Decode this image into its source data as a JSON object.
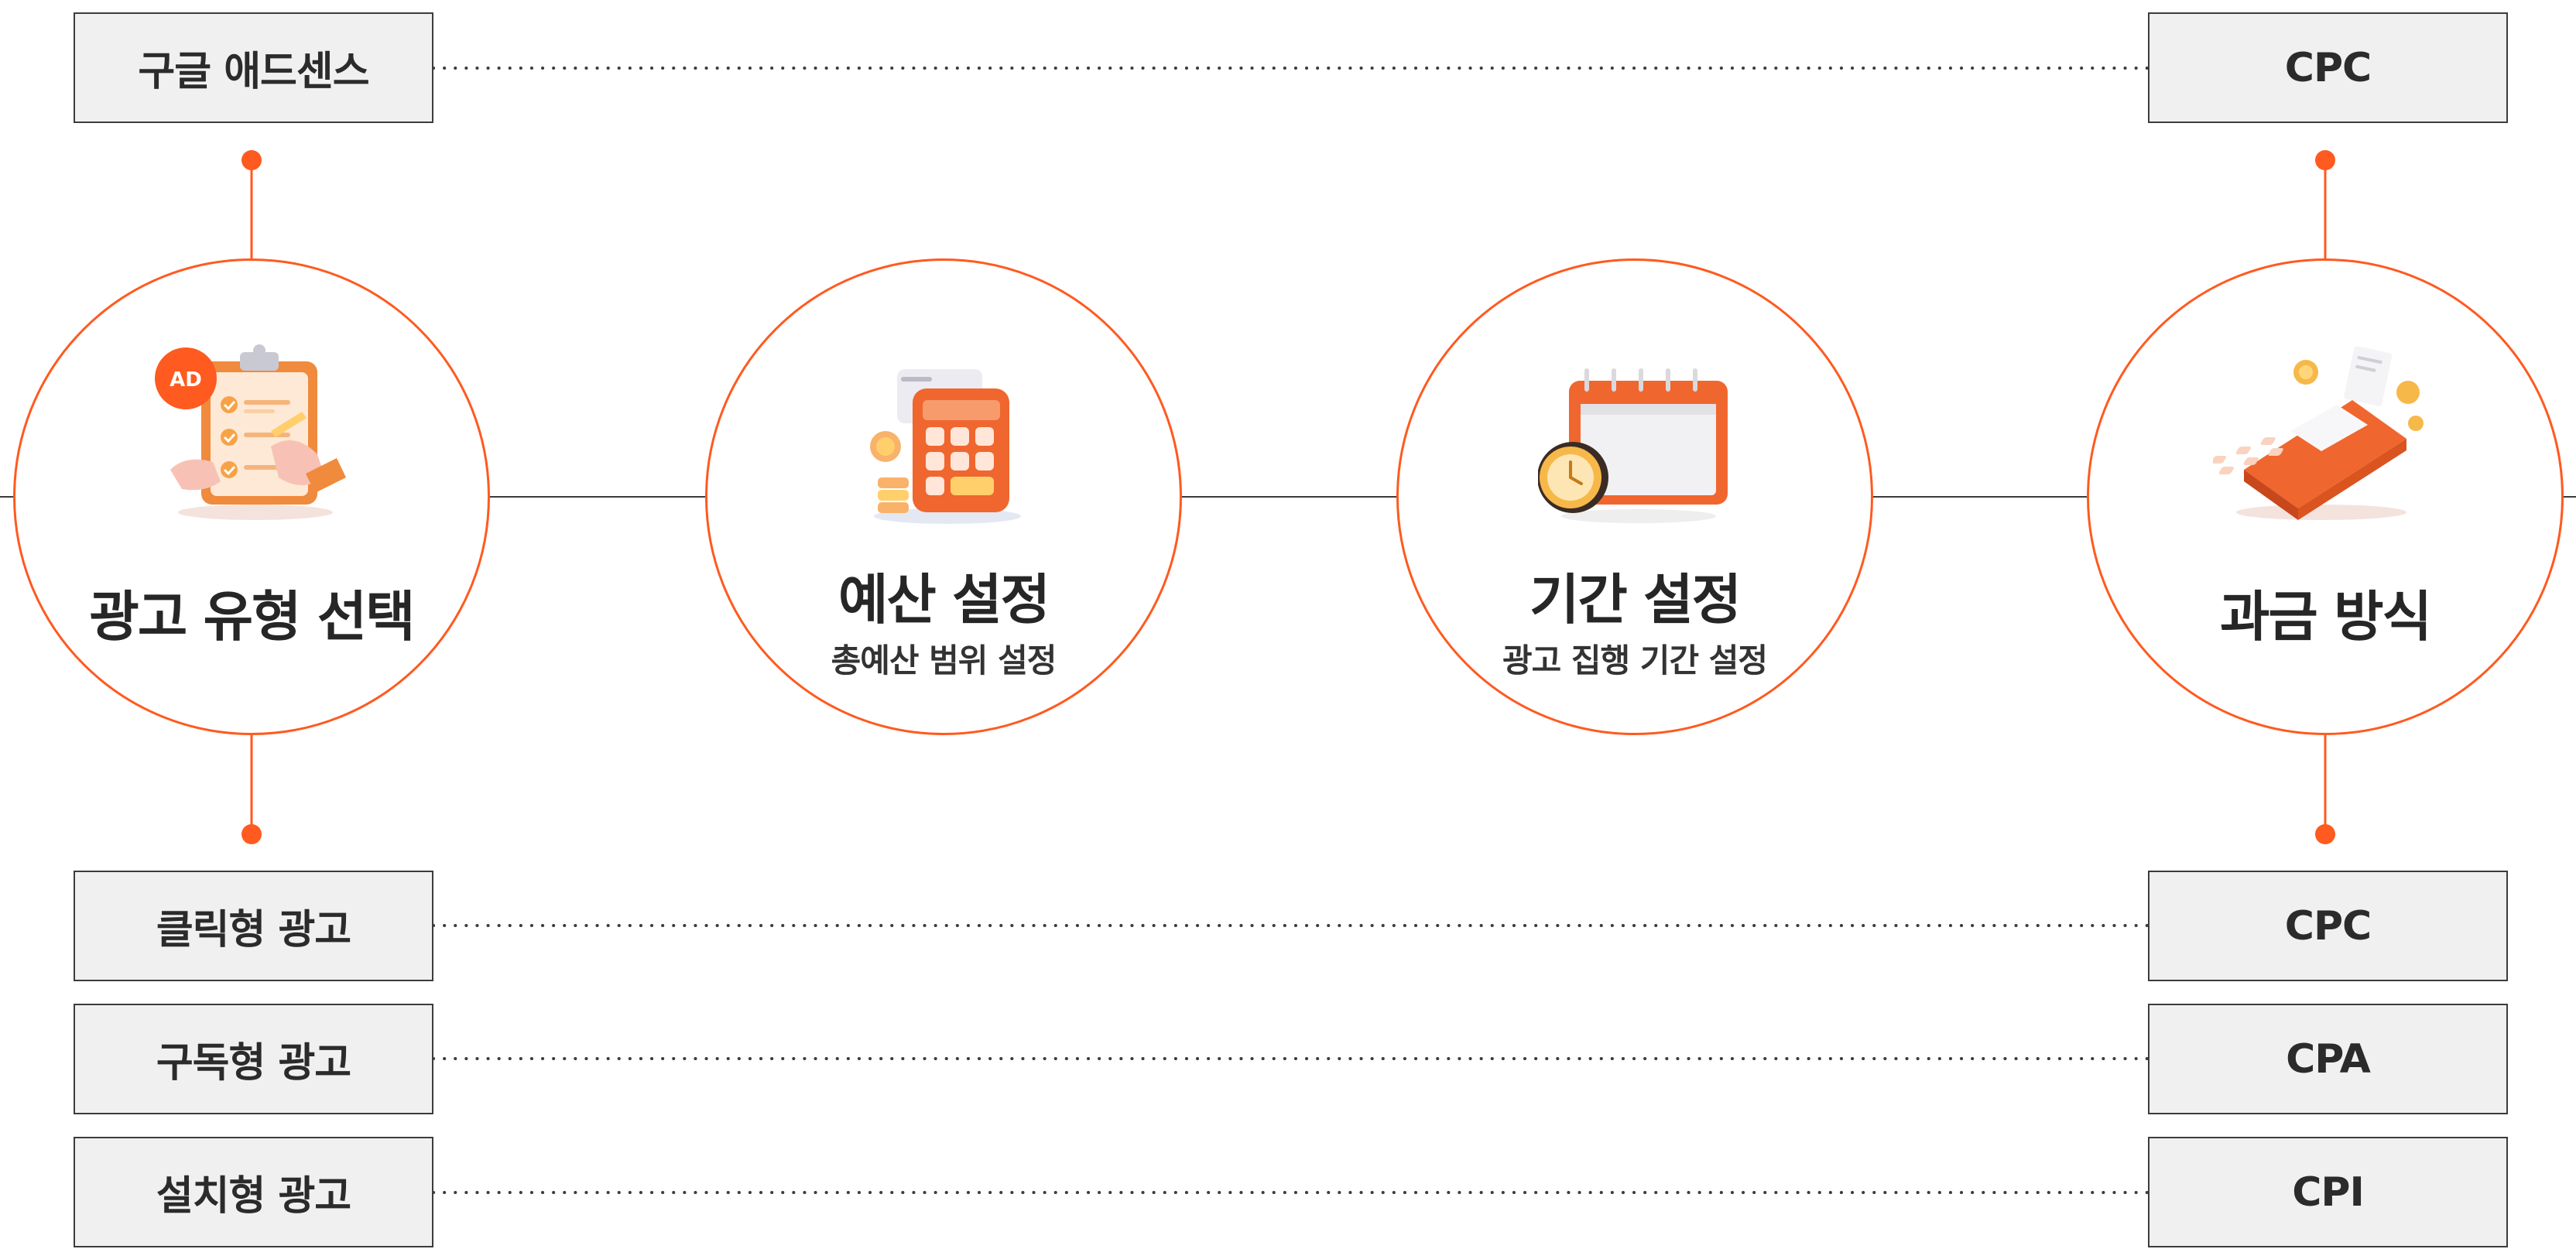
{
  "ad_network": "구글 애드센스",
  "ad_network_billing": "CPC",
  "steps": [
    {
      "title": "광고 유형 선택",
      "subtitle": "",
      "icon": "ad-clipboard-icon"
    },
    {
      "title": "예산 설정",
      "subtitle": "총예산 범위 설정",
      "icon": "calculator-icon"
    },
    {
      "title": "기간 설정",
      "subtitle": "광고 집행 기간 설정",
      "icon": "calendar-clock-icon"
    },
    {
      "title": "과금 방식",
      "subtitle": "",
      "icon": "card-terminal-icon"
    }
  ],
  "ad_types": [
    {
      "type": "클릭형 광고",
      "billing": "CPC"
    },
    {
      "type": "구독형 광고",
      "billing": "CPA"
    },
    {
      "type": "설치형 광고",
      "billing": "CPI"
    }
  ],
  "icon_badge": "AD",
  "colors": {
    "accent": "#ff5a1f",
    "box_fill": "#f0f0f0",
    "line": "#3c3c3c"
  }
}
